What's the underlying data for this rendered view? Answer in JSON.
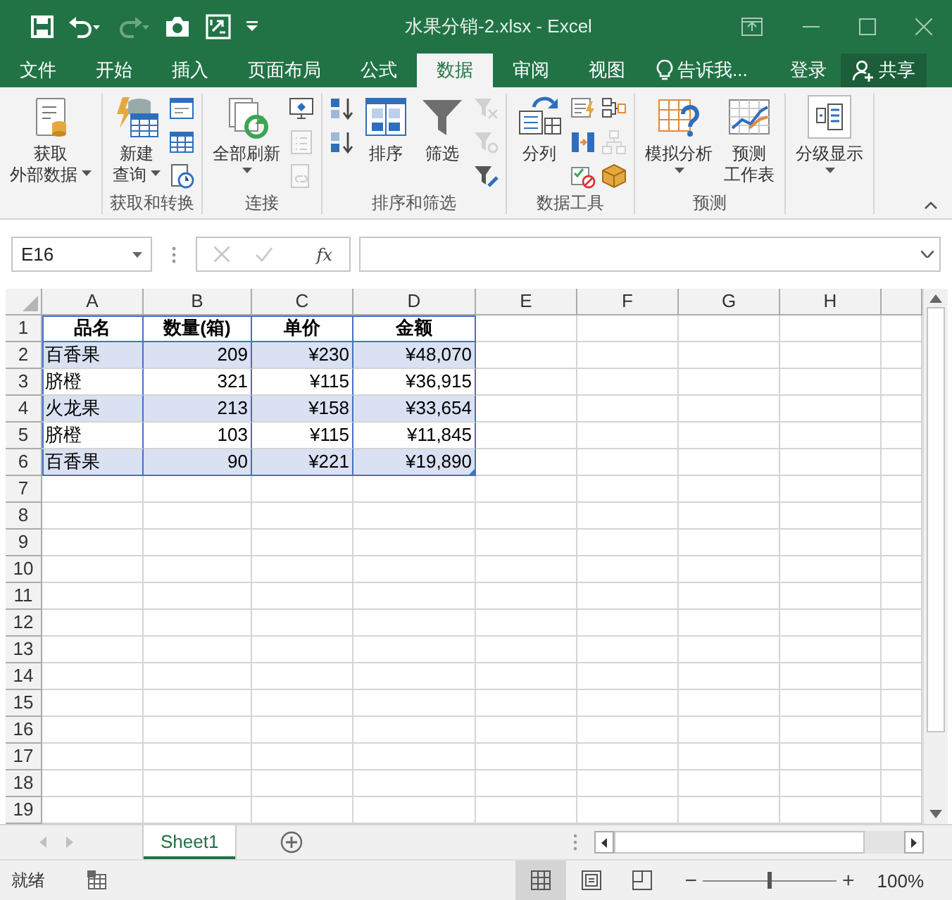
{
  "window": {
    "title": "水果分销-2.xlsx - Excel"
  },
  "ribbon_tabs": [
    {
      "label": "文件",
      "selected": false
    },
    {
      "label": "开始",
      "selected": false
    },
    {
      "label": "插入",
      "selected": false
    },
    {
      "label": "页面布局",
      "selected": false
    },
    {
      "label": "公式",
      "selected": false
    },
    {
      "label": "数据",
      "selected": true
    },
    {
      "label": "审阅",
      "selected": false
    },
    {
      "label": "视图",
      "selected": false
    }
  ],
  "tell_me": "告诉我...",
  "sign_in": "登录",
  "share": "共享",
  "ribbon": {
    "groups": [
      {
        "items": [
          {
            "kind": "large",
            "label": [
              "获取",
              "外部数据"
            ],
            "dropdown": true
          }
        ]
      },
      {
        "label": "获取和转换",
        "items": [
          {
            "kind": "large",
            "label": [
              "新建",
              "查询"
            ],
            "dropdown": true
          },
          {
            "kind": "icon",
            "disabled": false
          },
          {
            "kind": "icon",
            "disabled": false
          },
          {
            "kind": "icon",
            "disabled": false
          }
        ]
      },
      {
        "label": "连接",
        "items": [
          {
            "kind": "large",
            "label": [
              "全部刷新"
            ],
            "dropdown": true
          },
          {
            "kind": "icon",
            "disabled": false
          },
          {
            "kind": "icon",
            "disabled": true
          },
          {
            "kind": "icon",
            "disabled": true
          }
        ]
      },
      {
        "label": "排序和筛选",
        "items": [
          {
            "kind": "icon",
            "disabled": false
          },
          {
            "kind": "icon",
            "disabled": false
          },
          {
            "kind": "large",
            "label": [
              "排序"
            ],
            "dropdown": false
          },
          {
            "kind": "large",
            "label": [
              "筛选"
            ],
            "dropdown": false
          },
          {
            "kind": "icon",
            "disabled": true
          },
          {
            "kind": "icon",
            "disabled": true
          },
          {
            "kind": "icon",
            "disabled": false
          }
        ]
      },
      {
        "label": "数据工具",
        "items": [
          {
            "kind": "large",
            "label": [
              "分列"
            ],
            "dropdown": false
          },
          {
            "kind": "icon",
            "disabled": false
          },
          {
            "kind": "icon",
            "disabled": false
          },
          {
            "kind": "icon",
            "disabled": false
          },
          {
            "kind": "icon",
            "disabled": false
          },
          {
            "kind": "icon",
            "disabled": true
          },
          {
            "kind": "icon",
            "disabled": false
          }
        ]
      },
      {
        "label": "预测",
        "items": [
          {
            "kind": "large",
            "label": [
              "模拟分析"
            ],
            "dropdown": true
          },
          {
            "kind": "large",
            "label": [
              "预测",
              "工作表"
            ],
            "dropdown": false
          }
        ]
      },
      {
        "items": [
          {
            "kind": "large",
            "label": [
              "分级显示"
            ],
            "dropdown": true
          }
        ]
      }
    ]
  },
  "formula_bar": {
    "name_box": "E16",
    "function_label": "fx"
  },
  "sheet": {
    "columns": [
      "A",
      "B",
      "C",
      "D",
      "E",
      "F",
      "G",
      "H"
    ],
    "rows": [
      {
        "number": "1",
        "kind": "header",
        "shaded": false,
        "cells": [
          "品名",
          "数量(箱)",
          "单价",
          "金额"
        ]
      },
      {
        "number": "2",
        "kind": "data",
        "shaded": true,
        "cells": [
          "百香果",
          "209",
          "¥230",
          "¥48,070"
        ]
      },
      {
        "number": "3",
        "kind": "data",
        "shaded": false,
        "cells": [
          "脐橙",
          "321",
          "¥115",
          "¥36,915"
        ]
      },
      {
        "number": "4",
        "kind": "data",
        "shaded": true,
        "cells": [
          "火龙果",
          "213",
          "¥158",
          "¥33,654"
        ]
      },
      {
        "number": "5",
        "kind": "data",
        "shaded": false,
        "cells": [
          "脐橙",
          "103",
          "¥115",
          "¥11,845"
        ]
      },
      {
        "number": "6",
        "kind": "data",
        "shaded": true,
        "cells": [
          "百香果",
          "90",
          "¥221",
          "¥19,890"
        ]
      },
      {
        "number": "7"
      },
      {
        "number": "8"
      },
      {
        "number": "9"
      },
      {
        "number": "10"
      },
      {
        "number": "11"
      },
      {
        "number": "12"
      },
      {
        "number": "13"
      },
      {
        "number": "14"
      },
      {
        "number": "15"
      },
      {
        "number": "16"
      },
      {
        "number": "17"
      },
      {
        "number": "18"
      },
      {
        "number": "19"
      }
    ]
  },
  "sheet_tabs": [
    {
      "label": "Sheet1",
      "selected": true
    }
  ],
  "status_bar": {
    "status": "就绪",
    "views": [
      {
        "selected": true
      },
      {
        "selected": false
      },
      {
        "selected": false
      }
    ],
    "zoom_out": "−",
    "zoom_in": "+",
    "zoom": {
      "level": 0.5
    },
    "zoom_reading": "100%"
  }
}
